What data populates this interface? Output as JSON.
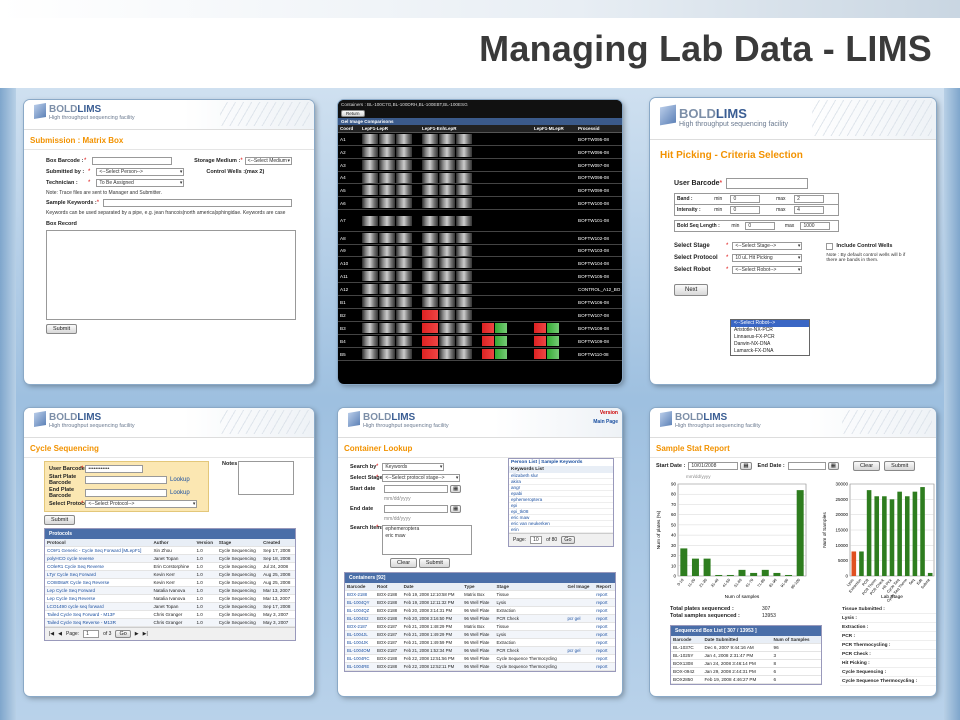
{
  "slide": {
    "title": "Managing Lab Data - LIMS"
  },
  "brand": {
    "name_a": "BOLD",
    "name_b": "LIMS",
    "subtitle": "High throughput sequencing facility",
    "accent": "#f29200"
  },
  "panel1": {
    "title": "Submission : Matrix Box",
    "box_barcode": "Box Barcode :",
    "submitted_by": "Submitted by :",
    "submitted_by_val": "<--Select Person-->",
    "technician": "Technician :",
    "technician_val": "To Be Assigned",
    "storage_medium": "Storage Medium :",
    "storage_val": "<--Select Medium",
    "control_wells": "Control Wells :(max 2)",
    "note": "Note: Trace files are sent to Manager and Submitter.",
    "sample_keywords": "Sample Keywords :",
    "kw_note": "Keywords can be used separated by a pipe, e.g. jean francois|north america|sphingidae. Keywords are case",
    "box_record": "Box Record",
    "submit": "Submit"
  },
  "panel2": {
    "containers": "Containers : BL-100C7G,BL-100DRH,BL-100EBT,BL-100ESG",
    "return": "Return",
    "section": "Gel Image Comparisons",
    "cols": [
      "Coord",
      "LepF1-LepR",
      "LepF1-EnhLepR",
      "",
      "LepF1-MLepR",
      "Processid"
    ],
    "rows": [
      {
        "c": "A1",
        "p": "BOFTW095-08"
      },
      {
        "c": "A2",
        "p": "BOFTW096-08"
      },
      {
        "c": "A3",
        "p": "BOFTW097-08"
      },
      {
        "c": "A4",
        "p": "BOFTW098-08"
      },
      {
        "c": "A5",
        "p": "BOFTW099-08"
      },
      {
        "c": "A6",
        "p": "BOFTW100-08"
      },
      {
        "c": "A7",
        "p": "BOFTW101-08"
      },
      {
        "c": "A8",
        "p": "BOFTW102-08"
      },
      {
        "c": "A9",
        "p": "BOFTW103-08"
      },
      {
        "c": "A10",
        "p": "BOFTW104-08"
      },
      {
        "c": "A11",
        "p": "BOFTW105-08"
      },
      {
        "c": "A12",
        "p": "CONTROL_A12_BO"
      },
      {
        "c": "B1",
        "p": "BOFTW106-08"
      },
      {
        "c": "B2",
        "p": "BOFTW107-08"
      },
      {
        "c": "B3",
        "p": "BOFTW108-08"
      },
      {
        "c": "B4",
        "p": "BOFTW109-08"
      },
      {
        "c": "B5",
        "p": "BOFTW110-08"
      }
    ]
  },
  "panel3": {
    "title": "Hit Picking - Criteria Selection",
    "user_barcode": "User Barcode",
    "band": "Band :",
    "intensity": "Intensity :",
    "min": "min",
    "max": "max",
    "band_min": "0",
    "band_max": "2",
    "int_min": "0",
    "int_max": "4",
    "bold_seq": "Bold Seq Length :",
    "seq_min": "0",
    "seq_max": "1000",
    "select_stage": "Select Stage",
    "stage_val": "<--Select Stage-->",
    "select_protocol": "Select Protocol",
    "protocol_val": "10 uL Hit Picking",
    "select_robot": "Select Robot",
    "robot_val": "<--Select Robot-->",
    "robot_options": [
      "<--Select Robot-->",
      "Aristotle-NX-PCR",
      "Linnaeus-FX-PCR",
      "Darwin-NX-DNA",
      "Lamarck-FX-DNA"
    ],
    "include": "Include Control Wells",
    "include_note": "Note : By default control wells will b if there are bands in them.",
    "next": "Next"
  },
  "panel4": {
    "title": "Cycle Sequencing",
    "user_barcode": "User Barcode",
    "user_val": "••••••••••••",
    "start_plate": "Start Plate Barcode",
    "end_plate": "End Plate Barcode",
    "lookup": "Lookup",
    "select_protocol": "Select Protocol",
    "protocol_val": "<--Select Protocol-->",
    "notes": "Notes",
    "submit": "Submit",
    "grid_title": "Protocols",
    "cols": [
      "Protocol",
      "Author",
      "Version",
      "Stage",
      "Created"
    ],
    "rows": [
      [
        "COI#1 Generic - Cycle Seq Forward [MLepF1]",
        "Xin Zhou",
        "1.0",
        "Cycle Sequencing",
        "Sep 17, 2008"
      ],
      [
        "polyHCO cycle reverse",
        "Janet Topan",
        "1.0",
        "Cycle Sequencing",
        "Sep 18, 2008"
      ],
      [
        "COleR1 Cycle Seq Reverse",
        "Erin Corstorphine",
        "1.0",
        "Cycle Sequencing",
        "Jul 24, 2008"
      ],
      [
        "LTyr Cycle Seq Forward",
        "Kevin Kerr",
        "1.0",
        "Cycle Sequencing",
        "Aug 25, 2008"
      ],
      [
        "COI808aR Cycle Seq Reverse",
        "Kevin Kerr",
        "1.0",
        "Cycle Sequencing",
        "Aug 25, 2008"
      ],
      [
        "Lep Cycle Seq Forward",
        "Natalia Ivanova",
        "1.0",
        "Cycle Sequencing",
        "Mar 13, 2007"
      ],
      [
        "Lep Cycle Seq Reverse",
        "Natalia Ivanova",
        "1.0",
        "Cycle Sequencing",
        "Mar 13, 2007"
      ],
      [
        "LCO1490 cycle seq forward",
        "Janet Topan",
        "1.0",
        "Cycle Sequencing",
        "Sep 17, 2008"
      ],
      [
        "Tailed Cycle Seq Forward - M13F",
        "Chris Granger",
        "1.0",
        "Cycle Sequencing",
        "May 3, 2007"
      ],
      [
        "Tailed Cycle Seq Reverse - M13R",
        "Chris Granger",
        "1.0",
        "Cycle Sequencing",
        "May 3, 2007"
      ]
    ],
    "page": "Page:",
    "page_val": "1",
    "of": "of 3",
    "go": "Go"
  },
  "panel5": {
    "version": "Version",
    "main_page": "Main Page",
    "title": "Container Lookup",
    "search_by": "Search by",
    "search_by_val": "Keywords",
    "select_stage": "Select Stage",
    "stage_val": "<--Select protocol stage-->",
    "start_date": "Start date",
    "end_date": "End date",
    "date_ph": "mm/dd/yyyy",
    "search_items": "Search Items",
    "items": "ephemeroptera\neric maw",
    "clear": "Clear",
    "submit": "Submit",
    "list_tabs": "Person List | Sample Keywords",
    "kw_head": "Keywords List",
    "keywords": [
      "elizabeth slur",
      "akira",
      "angr",
      "epabi",
      "ephemeroptera",
      "epi",
      "epi_tk08",
      "eric maw",
      "eric van neukerken",
      "erin"
    ],
    "page": "Page:",
    "page_val": "10",
    "of": "of 80",
    "go": "Go",
    "grid_title": "Containers [92]",
    "cols": [
      "Barcode",
      "Root",
      "Date",
      "Type",
      "Stage",
      "Gel Image",
      "Report"
    ],
    "rows": [
      [
        "BOX-2188",
        "BOX-2188",
        "Feb 19, 2008 12:10:58 PM",
        "Matrix Box",
        "Tissue",
        "",
        "report"
      ],
      [
        "BL-1004QY",
        "BOX-2188",
        "Feb 19, 2008 12:11:32 PM",
        "96 Well Plate",
        "Lysis",
        "",
        "report"
      ],
      [
        "BL-1004QZ",
        "BOX-2188",
        "Feb 20, 2008 3:14:31 PM",
        "96 Well Plate",
        "Extraction",
        "",
        "report"
      ],
      [
        "BL-1004S2",
        "BOX-2188",
        "Feb 20, 2008 3:16:50 PM",
        "96 Well Plate",
        "PCR Check",
        "pcr gel",
        "report"
      ],
      [
        "BOX-2187",
        "BOX-2187",
        "Feb 21, 2008 1:48:29 PM",
        "Matrix Box",
        "Tissue",
        "",
        "report"
      ],
      [
        "BL-1004JL",
        "BOX-2187",
        "Feb 21, 2008 1:49:29 PM",
        "96 Well Plate",
        "Lysis",
        "",
        "report"
      ],
      [
        "BL-1004JK",
        "BOX-2187",
        "Feb 21, 2008 1:49:59 PM",
        "96 Well Plate",
        "Extraction",
        "",
        "report"
      ],
      [
        "BL-1004OM",
        "BOX-2187",
        "Feb 21, 2008 1:52:34 PM",
        "96 Well Plate",
        "PCR Check",
        "pcr gel",
        "report"
      ],
      [
        "BL-1004RC",
        "BOX-2188",
        "Feb 22, 2008 12:51:56 PM",
        "96 Well Plate",
        "Cycle Sequence Thermocycling",
        "",
        "report"
      ],
      [
        "BL-1004RE",
        "BOX-2188",
        "Feb 22, 2008 12:52:11 PM",
        "96 Well Plate",
        "Cycle Sequence Thermocycling",
        "",
        "report"
      ]
    ]
  },
  "panel6": {
    "title": "Sample Stat Report",
    "start_date": "Start Date :",
    "start_val": "10/01/2008",
    "date_ph": "mm/dd/yyyy",
    "end_date": "End Date :",
    "clear": "Clear",
    "submit": "Submit",
    "chart1_xlabel": "Num of samples",
    "chart1_ylabel": "Num of plates (%)",
    "chart2_ylabel": "Num of Samples",
    "chart2_xlabel": "Lab Stage",
    "total_plates": "Total plates sequenced :",
    "total_plates_val": "307",
    "total_samples": "Total samples sequenced :",
    "total_samples_val": "13953",
    "seq_box_title": "Sequenced Box List [ 307 / 13953 ]",
    "seq_cols": [
      "Barcode",
      "Date Submitted",
      "Num of Samples"
    ],
    "seq_rows": [
      [
        "BL-1037C",
        "Dec 6, 2007 9:44:16 AM",
        "96"
      ],
      [
        "BL-1025Y",
        "Jan 4, 2008 2:31:47 PM",
        "3"
      ],
      [
        "BOX1308",
        "Jan 24, 2008 3:46:14 PM",
        "8"
      ],
      [
        "BOX-0942",
        "Jan 29, 2008 2:44:31 PM",
        "6"
      ],
      [
        "BOX2850",
        "Feb 19, 2008 4:46:27 PM",
        "6"
      ]
    ],
    "stages": [
      "Tissue Submitted :",
      "Lysis :",
      "Extraction :",
      "PCR :",
      "PCR Thermocycling :",
      "PCR Check :",
      "Hit Picking :",
      "Cycle Sequencing :",
      "Cycle Sequence Thermocycling :"
    ]
  },
  "chart_data": [
    {
      "type": "bar",
      "x": [
        "0-10",
        "11-20",
        "21-30",
        "31-40",
        "41-50",
        "51-60",
        "61-70",
        "71-80",
        "81-90",
        "91-96",
        "96-100"
      ],
      "values": [
        27,
        17,
        17,
        1,
        1,
        6,
        3,
        6,
        3,
        1,
        84
      ],
      "ylim": [
        0,
        90
      ],
      "yticks": [
        0,
        10,
        20,
        30,
        40,
        50,
        60,
        70,
        80,
        90
      ],
      "xlabel": "Num of samples",
      "ylabel": "Num of plates (%)",
      "color": "#2e7d1f"
    },
    {
      "type": "bar",
      "x": [
        "Lysis",
        "Extraction",
        "PCR",
        "PCR Therm",
        "PCR Check",
        "Hit Pick",
        "Cycle Seq",
        "Cycle Seq Therm",
        "Seq",
        "Edit",
        "Submit"
      ],
      "values": [
        8000,
        8000,
        28000,
        26000,
        26000,
        25000,
        27500,
        26000,
        27500,
        29000,
        1000
      ],
      "ylim": [
        0,
        30000
      ],
      "yticks": [
        0,
        5000,
        10000,
        15000,
        20000,
        25000,
        30000
      ],
      "xlabel": "Lab Stage",
      "ylabel": "Num of Samples",
      "colors": [
        "#e05020",
        "#2e7d1f",
        "#2e7d1f",
        "#2e7d1f",
        "#2e7d1f",
        "#2e7d1f",
        "#2e7d1f",
        "#2e7d1f",
        "#2e7d1f",
        "#2e7d1f",
        "#2e7d1f"
      ]
    }
  ]
}
